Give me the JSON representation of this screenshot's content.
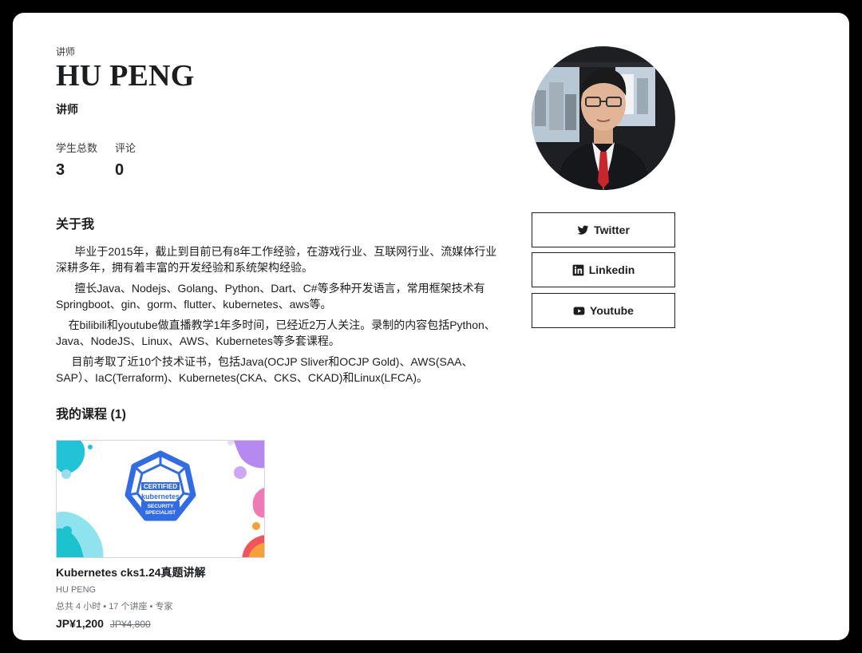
{
  "header": {
    "eyebrow": "讲师",
    "name": "HU PENG",
    "subtitle": "讲师"
  },
  "stats": [
    {
      "label": "学生总数",
      "value": "3"
    },
    {
      "label": "评论",
      "value": "0"
    }
  ],
  "about": {
    "title": "关于我",
    "paragraphs": [
      "      毕业于2015年，截止到目前已有8年工作经验，在游戏行业、互联网行业、流媒体行业深耕多年，拥有着丰富的开发经验和系统架构经验。",
      "      擅长Java、Nodejs、Golang、Python、Dart、C#等多种开发语言，常用框架技术有Springboot、gin、gorm、flutter、kubernetes、aws等。",
      "    在bilibili和youtube做直播教学1年多时间，已经近2万人关注。录制的内容包括Python、Java、NodeJS、Linux、AWS、Kubernetes等多套课程。",
      "     目前考取了近10个技术证书，包括Java(OCJP Sliver和OCJP Gold)、AWS(SAA、SAP）、IaC(Terraform)、Kubernetes(CKA、CKS、CKAD)和Linux(LFCA)。"
    ]
  },
  "courses": {
    "title": "我的课程 (1)",
    "items": [
      {
        "title": "Kubernetes cks1.24真题讲解",
        "author": "HU PENG",
        "meta": "总共 4 小时 • 17 个讲座 • 专家",
        "price": "JP¥1,200",
        "original_price": "JP¥4,800",
        "badge": {
          "line1": "CERTIFIED",
          "line2": "kubernetes",
          "line3": "SECURITY",
          "line4": "SPECIALIST"
        }
      }
    ]
  },
  "social": {
    "twitter": "Twitter",
    "linkedin": "Linkedin",
    "youtube": "Youtube"
  },
  "colors": {
    "kube_blue": "#326ce5",
    "text": "#1c1d1f",
    "muted": "#6a6f73"
  }
}
